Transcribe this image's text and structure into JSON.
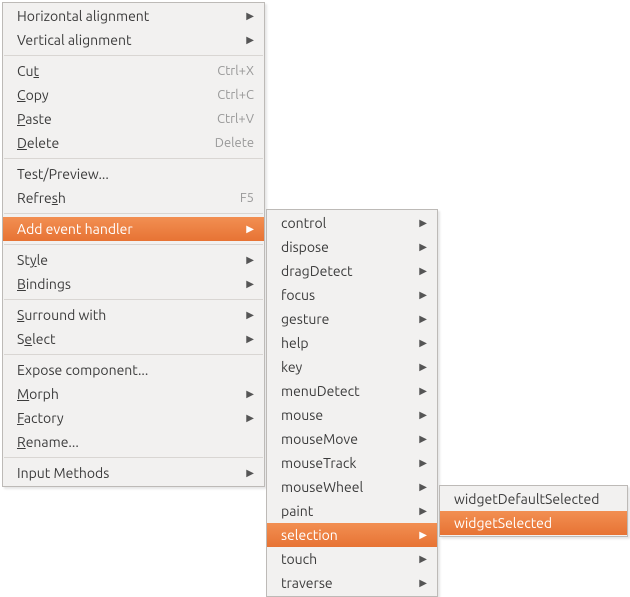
{
  "menu1": {
    "horizontal_alignment": {
      "text": "Horizontal alignment",
      "u": ""
    },
    "vertical_alignment": {
      "text": "Vertical alignment",
      "u": ""
    },
    "cut": {
      "pre": "Cu",
      "u": "t",
      "post": "",
      "accel": "Ctrl+X"
    },
    "copy": {
      "pre": "",
      "u": "C",
      "post": "opy",
      "accel": "Ctrl+C"
    },
    "paste": {
      "pre": "",
      "u": "P",
      "post": "aste",
      "accel": "Ctrl+V"
    },
    "delete": {
      "pre": "",
      "u": "D",
      "post": "elete",
      "accel": "Delete"
    },
    "test_preview": {
      "text": "Test/Preview..."
    },
    "refresh": {
      "pre": "Refre",
      "u": "s",
      "post": "h",
      "accel": "F5"
    },
    "add_event_handler": {
      "text": "Add event handler"
    },
    "style": {
      "pre": "St",
      "u": "y",
      "post": "le"
    },
    "bindings": {
      "pre": "",
      "u": "B",
      "post": "indings"
    },
    "surround_with": {
      "pre": "",
      "u": "S",
      "post": "urround with"
    },
    "select": {
      "pre": "S",
      "u": "e",
      "post": "lect"
    },
    "expose_component": {
      "text": "Expose component..."
    },
    "morph": {
      "pre": "",
      "u": "M",
      "post": "orph"
    },
    "factory": {
      "pre": "",
      "u": "F",
      "post": "actory"
    },
    "rename": {
      "pre": "",
      "u": "R",
      "post": "ename..."
    },
    "input_methods": {
      "text": "Input Methods"
    }
  },
  "menu2": {
    "control": "control",
    "dispose": "dispose",
    "dragDetect": "dragDetect",
    "focus": "focus",
    "gesture": "gesture",
    "help": "help",
    "key": "key",
    "menuDetect": "menuDetect",
    "mouse": "mouse",
    "mouseMove": "mouseMove",
    "mouseTrack": "mouseTrack",
    "mouseWheel": "mouseWheel",
    "paint": "paint",
    "selection": "selection",
    "touch": "touch",
    "traverse": "traverse"
  },
  "menu3": {
    "widgetDefaultSelected": "widgetDefaultSelected",
    "widgetSelected": "widgetSelected"
  }
}
